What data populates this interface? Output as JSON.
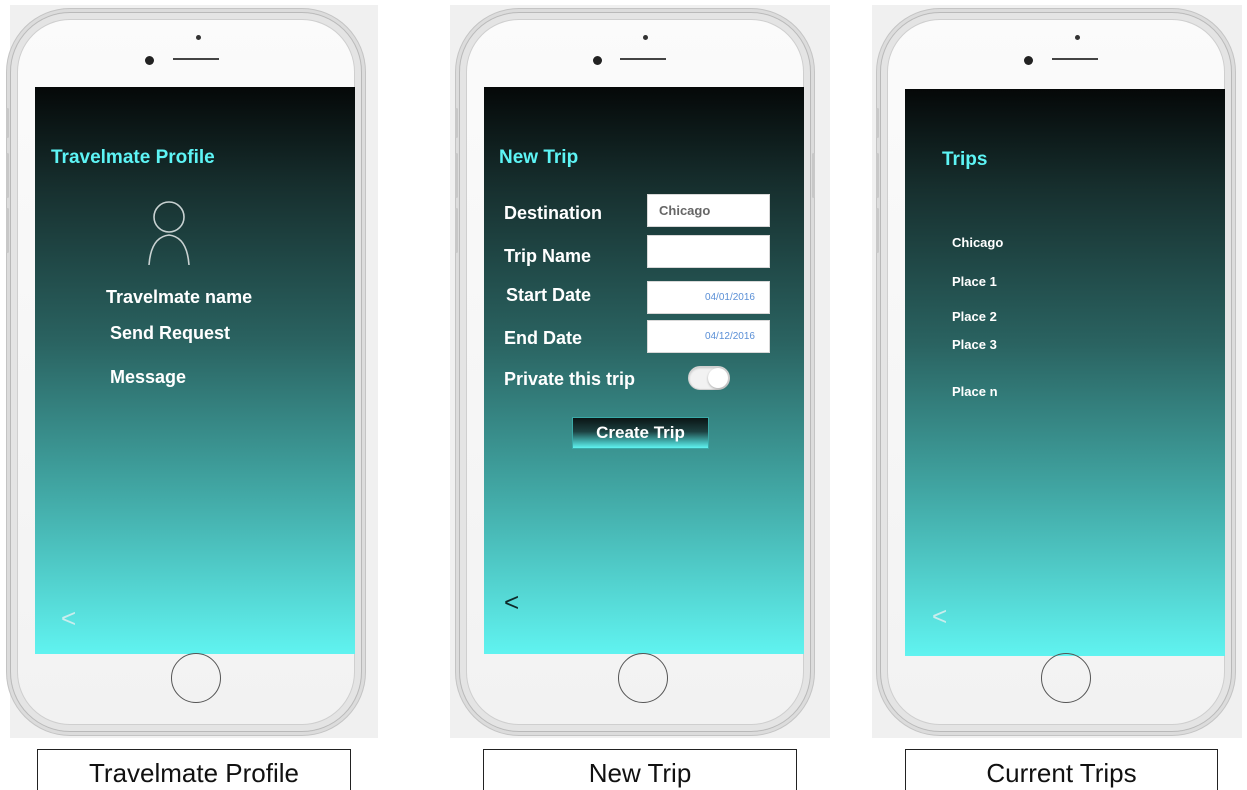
{
  "profile": {
    "title": "Travelmate Profile",
    "name": "Travelmate name",
    "send_request": "Send Request",
    "message": "Message",
    "back": "<",
    "caption": "Travelmate Profile"
  },
  "new_trip": {
    "title": "New Trip",
    "destination_label": "Destination",
    "destination_value": "Chicago",
    "trip_name_label": "Trip Name",
    "trip_name_value": "",
    "start_date_label": "Start Date",
    "start_date_value": "04/01/2016",
    "end_date_label": "End Date",
    "end_date_value": "04/12/2016",
    "private_label": "Private this trip",
    "create_label": "Create Trip",
    "back": "<",
    "caption": "New Trip"
  },
  "trips": {
    "title": "Trips",
    "items": [
      "Chicago",
      "Place 1",
      "Place 2",
      "Place 3",
      "Place n"
    ],
    "back": "<",
    "caption": "Current Trips"
  },
  "colors": {
    "accent": "#5df4f5",
    "gradient_top": "#050808",
    "gradient_bottom": "#60f3f0",
    "date_text": "#5a8fd6"
  },
  "icons": [
    "user-avatar-icon",
    "chevron-left-icon",
    "home-button-icon"
  ]
}
